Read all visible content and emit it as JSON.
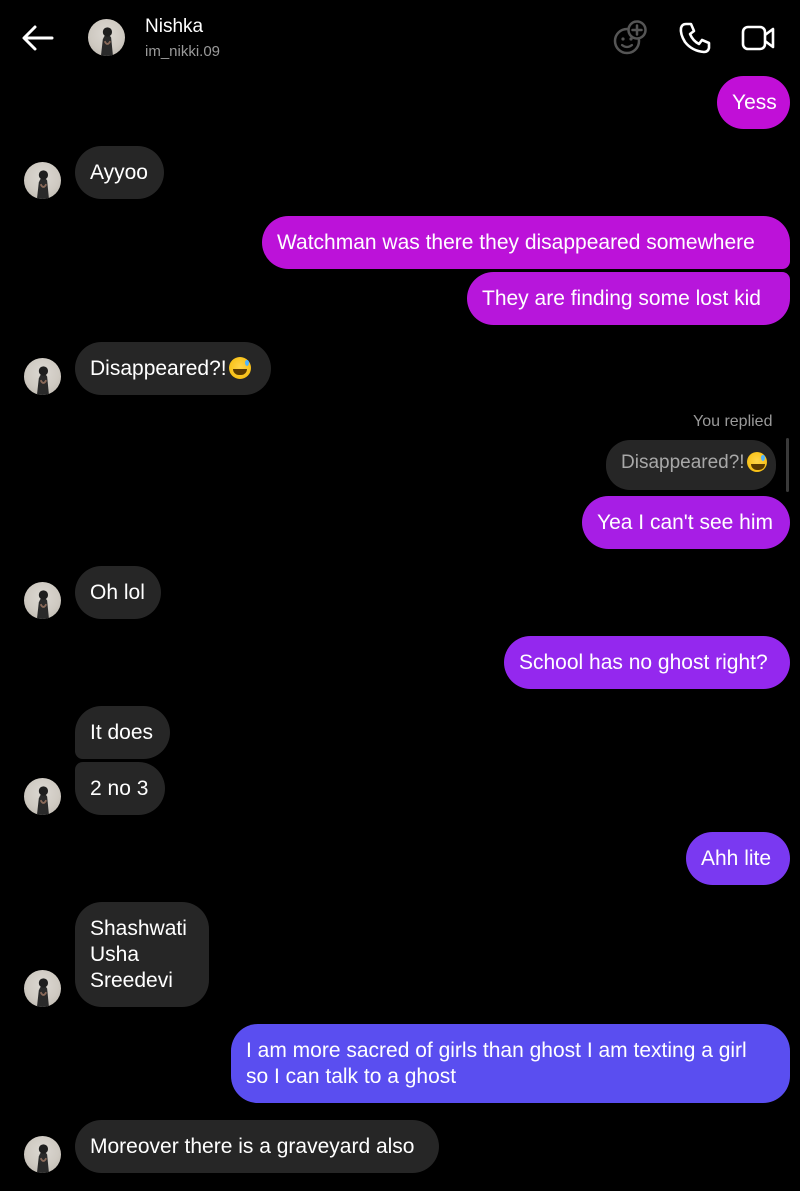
{
  "header": {
    "name": "Nishka",
    "username": "im_nikki.09",
    "icons": [
      "back-arrow-icon",
      "effects-icon",
      "phone-icon",
      "video-icon"
    ]
  },
  "colors": {
    "background": "#000000",
    "incoming_bubble": "#262626",
    "outgoing_gradient": [
      "#c10fd7",
      "#a81ee6",
      "#8a2ff0",
      "#6b42f2",
      "#5a4ef0"
    ]
  },
  "messages": [
    {
      "side": "out",
      "text": "Yess"
    },
    {
      "side": "in",
      "text": "Ayyoo"
    },
    {
      "side": "out",
      "text": "Watchman was there they disappeared somewhere"
    },
    {
      "side": "out",
      "text": "They are finding some lost kid"
    },
    {
      "side": "in",
      "text": "Disappeared?!",
      "emoji": "sweat-smile-emoji"
    },
    {
      "side": "out",
      "reply_label": "You replied",
      "quoted": "Disappeared?!",
      "quoted_emoji": "sweat-smile-emoji",
      "text": "Yea I can't see him"
    },
    {
      "side": "in",
      "text": "Oh lol"
    },
    {
      "side": "out",
      "text": "School has no ghost right?"
    },
    {
      "side": "in",
      "text": "It does"
    },
    {
      "side": "in",
      "text": "2 no 3"
    },
    {
      "side": "out",
      "text": "Ahh lite"
    },
    {
      "side": "in",
      "lines": [
        "Shashwati",
        "Usha",
        "Sreedevi"
      ]
    },
    {
      "side": "out",
      "lines": [
        "I am more sacred of girls than ghost I am texting a girl",
        "so I can talk to a ghost"
      ]
    },
    {
      "side": "in",
      "text": "Moreover there is a graveyard also"
    }
  ]
}
